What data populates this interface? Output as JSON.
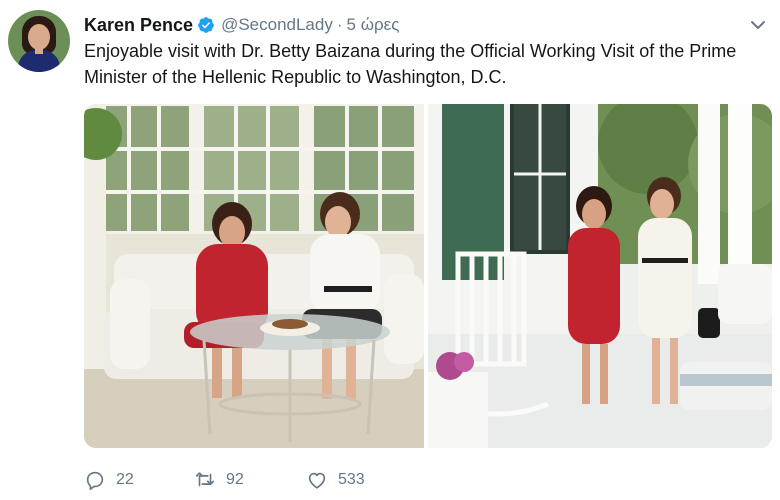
{
  "tweet": {
    "author_name": "Karen Pence",
    "handle": "@SecondLady",
    "separator": "·",
    "time": "5 ώρες",
    "text": "Enjoyable visit with Dr. Betty Baizana during the Official Working Visit of the Prime Minister of the Hellenic Republic to Washington, D.C.",
    "verified": true
  },
  "icons": {
    "verified": "verified-badge-icon",
    "menu": "chevron-down-icon",
    "reply": "reply-icon",
    "retweet": "retweet-icon",
    "like": "heart-icon"
  },
  "actions": {
    "replies": "22",
    "retweets": "92",
    "likes": "533"
  },
  "colors": {
    "accent": "#1da1f2",
    "muted": "#657786",
    "text": "#14171a"
  }
}
